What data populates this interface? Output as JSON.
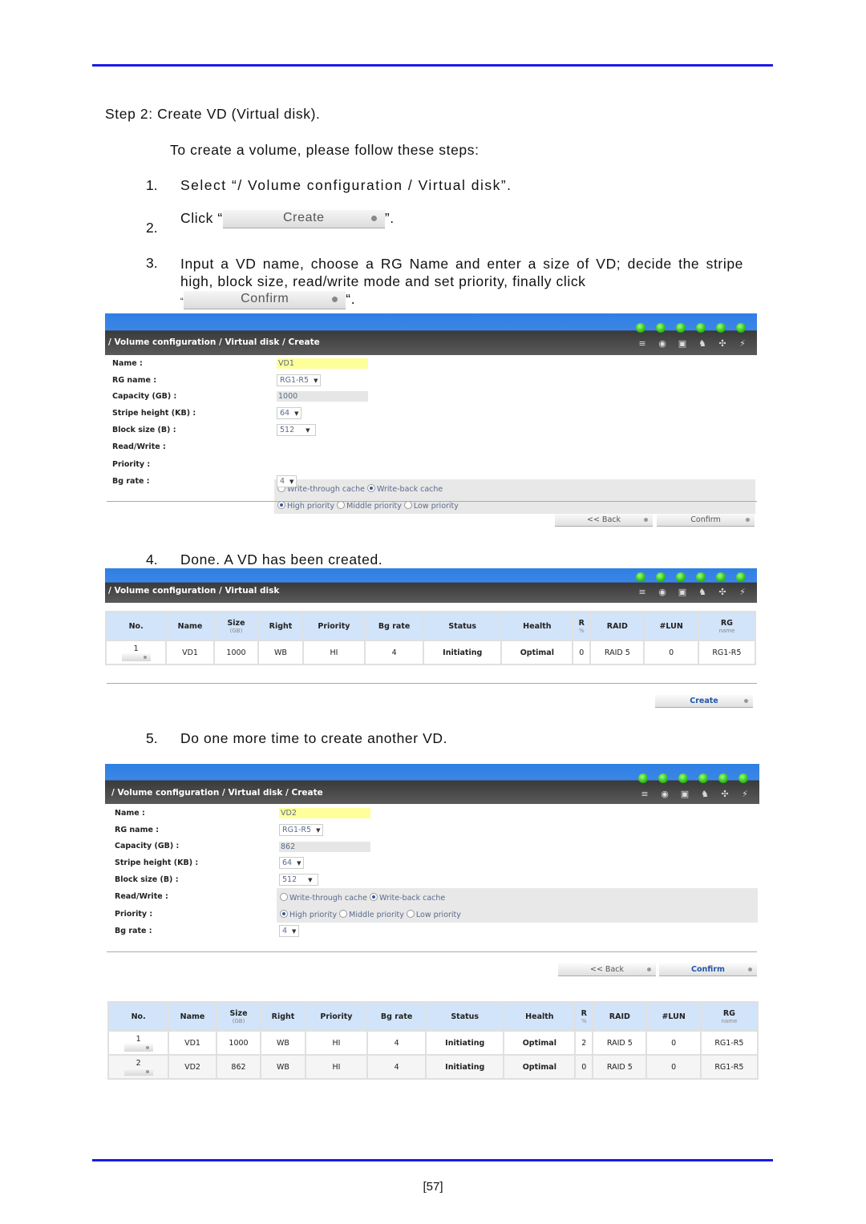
{
  "doc": {
    "step_heading": "Step 2: Create VD (Virtual disk).",
    "intro": "To create a volume, please follow these steps:",
    "steps": [
      {
        "num": "1.",
        "text": "Select “/ Volume configuration / Virtual disk”."
      },
      {
        "num": "2.",
        "prefix": "Click “",
        "button": "Create",
        "suffix": "”."
      },
      {
        "num": "3.",
        "text": "Input a VD name, choose a RG Name and enter a size of VD; decide the stripe high, block size, read/write mode and set priority, finally click",
        "open_quote": "“",
        "button": "Confirm",
        "suffix": "“."
      },
      {
        "num": "4.",
        "text": "Done. A VD has been created."
      },
      {
        "num": "5.",
        "text": "Do one more time to create another VD."
      }
    ],
    "page_number": "[57]"
  },
  "header_icons": [
    "disk-stack-icon",
    "thermometer-icon",
    "power-supply-icon",
    "ups-icon",
    "fan-icon",
    "voltage-icon"
  ],
  "status_leds": [
    "green",
    "green",
    "green",
    "green",
    "green",
    "green"
  ],
  "form_labels": {
    "name": "Name :",
    "rg_name": "RG name :",
    "capacity": "Capacity (GB) :",
    "stripe": "Stripe height (KB) :",
    "block": "Block size (B) :",
    "rw": "Read/Write :",
    "priority": "Priority :",
    "bg_rate": "Bg rate :"
  },
  "radio_options": {
    "write_through": "Write-through cache",
    "write_back": "Write-back cache",
    "high": "High priority",
    "middle": "Middle priority",
    "low": "Low priority"
  },
  "panel1": {
    "breadcrumb": "/ Volume configuration / Virtual disk / Create",
    "name": "VD1",
    "rg_name": "RG1-R5",
    "capacity": "1000",
    "stripe": "64",
    "block": "512",
    "rw_selected": "Write-back cache",
    "priority_selected": "High priority",
    "bg_rate": "4",
    "back_label": "<< Back",
    "confirm_label": "Confirm"
  },
  "panel2": {
    "breadcrumb": "/ Volume configuration / Virtual disk",
    "create_label": "Create"
  },
  "panel3": {
    "breadcrumb": "/ Volume configuration / Virtual disk / Create",
    "name": "VD2",
    "rg_name": "RG1-R5",
    "capacity": "862",
    "stripe": "64",
    "block": "512",
    "rw_selected": "Write-back cache",
    "priority_selected": "High priority",
    "bg_rate": "4",
    "back_label": "<< Back",
    "confirm_label": "Confirm"
  },
  "table_headers": {
    "no": "No.",
    "name": "Name",
    "size": "Size",
    "size_unit": "(GB)",
    "right": "Right",
    "priority": "Priority",
    "bg_rate": "Bg rate",
    "status": "Status",
    "health": "Health",
    "r": "R",
    "r_unit": "%",
    "raid": "RAID",
    "lun": "#LUN",
    "rg": "RG",
    "rg_sub": "name"
  },
  "table1": [
    {
      "no": "1",
      "name": "VD1",
      "size": "1000",
      "right": "WB",
      "priority": "HI",
      "bg_rate": "4",
      "status": "Initiating",
      "health": "Optimal",
      "r": "0",
      "raid": "RAID 5",
      "lun": "0",
      "rg": "RG1-R5"
    }
  ],
  "table2": [
    {
      "no": "1",
      "name": "VD1",
      "size": "1000",
      "right": "WB",
      "priority": "HI",
      "bg_rate": "4",
      "status": "Initiating",
      "health": "Optimal",
      "r": "2",
      "raid": "RAID 5",
      "lun": "0",
      "rg": "RG1-R5"
    },
    {
      "no": "2",
      "name": "VD2",
      "size": "862",
      "right": "WB",
      "priority": "HI",
      "bg_rate": "4",
      "status": "Initiating",
      "health": "Optimal",
      "r": "0",
      "raid": "RAID 5",
      "lun": "0",
      "rg": "RG1-R5"
    }
  ]
}
